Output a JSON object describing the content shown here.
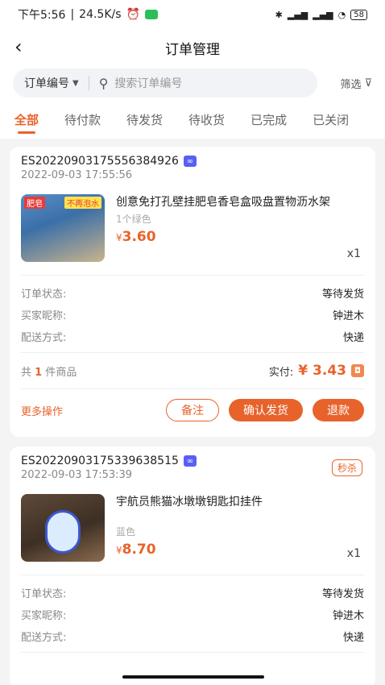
{
  "status_bar": {
    "time": "下午5:56",
    "speed": "24.5K/s",
    "battery": "58"
  },
  "nav": {
    "title": "订单管理"
  },
  "search": {
    "select_label": "订单编号",
    "placeholder": "搜索订单编号",
    "filter_label": "筛选"
  },
  "tabs": [
    "全部",
    "待付款",
    "待发货",
    "待收货",
    "已完成",
    "已关闭"
  ],
  "orders": [
    {
      "order_no": "ES20220903175556384926",
      "time": "2022-09-03 17:55:56",
      "product_name": "创意免打孔壁挂肥皂香皂盒吸盘置物沥水架",
      "thumb_badge_1": "肥皂",
      "thumb_badge_2": "不再泡水",
      "variant": "1个绿色",
      "price_symbol": "¥",
      "price": "3.60",
      "qty": "x1",
      "status_label": "订单状态:",
      "status_value": "等待发货",
      "buyer_label": "买家昵称:",
      "buyer_value": "钟进木",
      "ship_label": "配送方式:",
      "ship_value": "快递",
      "total_prefix": "共",
      "total_count": "1",
      "total_suffix": "件商品",
      "pay_label": "实付:",
      "pay_amount": "¥ 3.43",
      "more_label": "更多操作",
      "btn_note": "备注",
      "btn_ship": "确认发货",
      "btn_refund": "退款"
    },
    {
      "order_no": "ES20220903175339638515",
      "time": "2022-09-03 17:53:39",
      "tag": "秒杀",
      "product_name": "宇航员熊猫冰墩墩钥匙扣挂件",
      "variant": "蓝色",
      "price_symbol": "¥",
      "price": "8.70",
      "qty": "x1",
      "status_label": "订单状态:",
      "status_value": "等待发货",
      "buyer_label": "买家昵称:",
      "buyer_value": "钟进木",
      "ship_label": "配送方式:",
      "ship_value": "快递"
    }
  ],
  "colors": {
    "accent": "#e8632b",
    "link_icon": "#5a5ef5"
  }
}
